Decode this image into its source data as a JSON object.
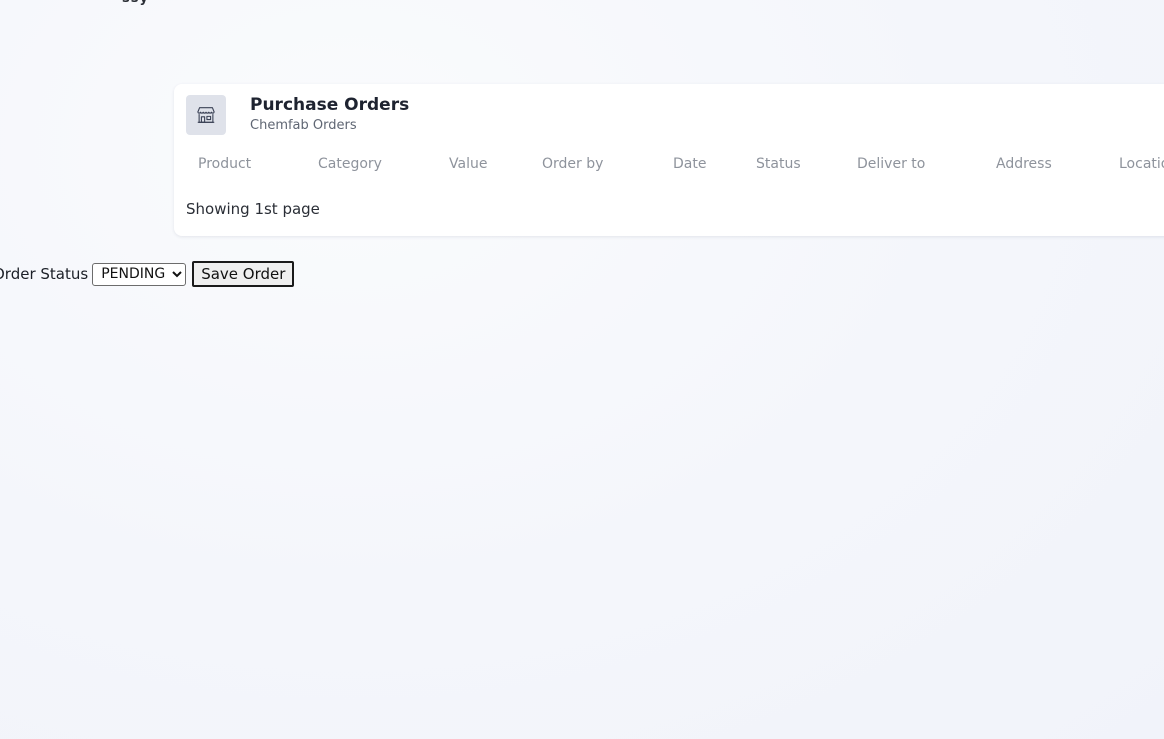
{
  "top_fragment": "ssy",
  "card": {
    "icon": "storefront-icon",
    "title": "Purchase Orders",
    "subtitle": "Chemfab Orders",
    "columns": [
      "Product",
      "Category",
      "Value",
      "Order by",
      "Date",
      "Status",
      "Deliver to",
      "Address",
      "Location"
    ],
    "footer": "Showing 1st page"
  },
  "order_form": {
    "status_label": "Order Status",
    "selected_status": "PENDING",
    "save_label": "Save Order"
  }
}
